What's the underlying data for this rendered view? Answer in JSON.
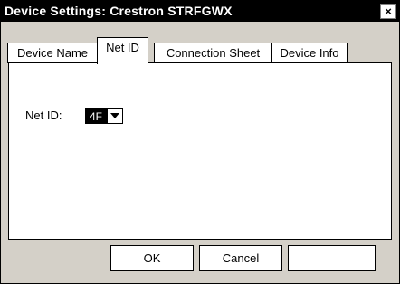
{
  "window": {
    "title": "Device Settings: Crestron STRFGWX"
  },
  "tabs": [
    {
      "label": "Device Name"
    },
    {
      "label": "Net ID"
    },
    {
      "label": "Connection Sheet"
    },
    {
      "label": "Device Info"
    }
  ],
  "net_id": {
    "label": "Net ID:",
    "value": "4F"
  },
  "buttons": {
    "ok": "OK",
    "cancel": "Cancel",
    "third": ""
  }
}
